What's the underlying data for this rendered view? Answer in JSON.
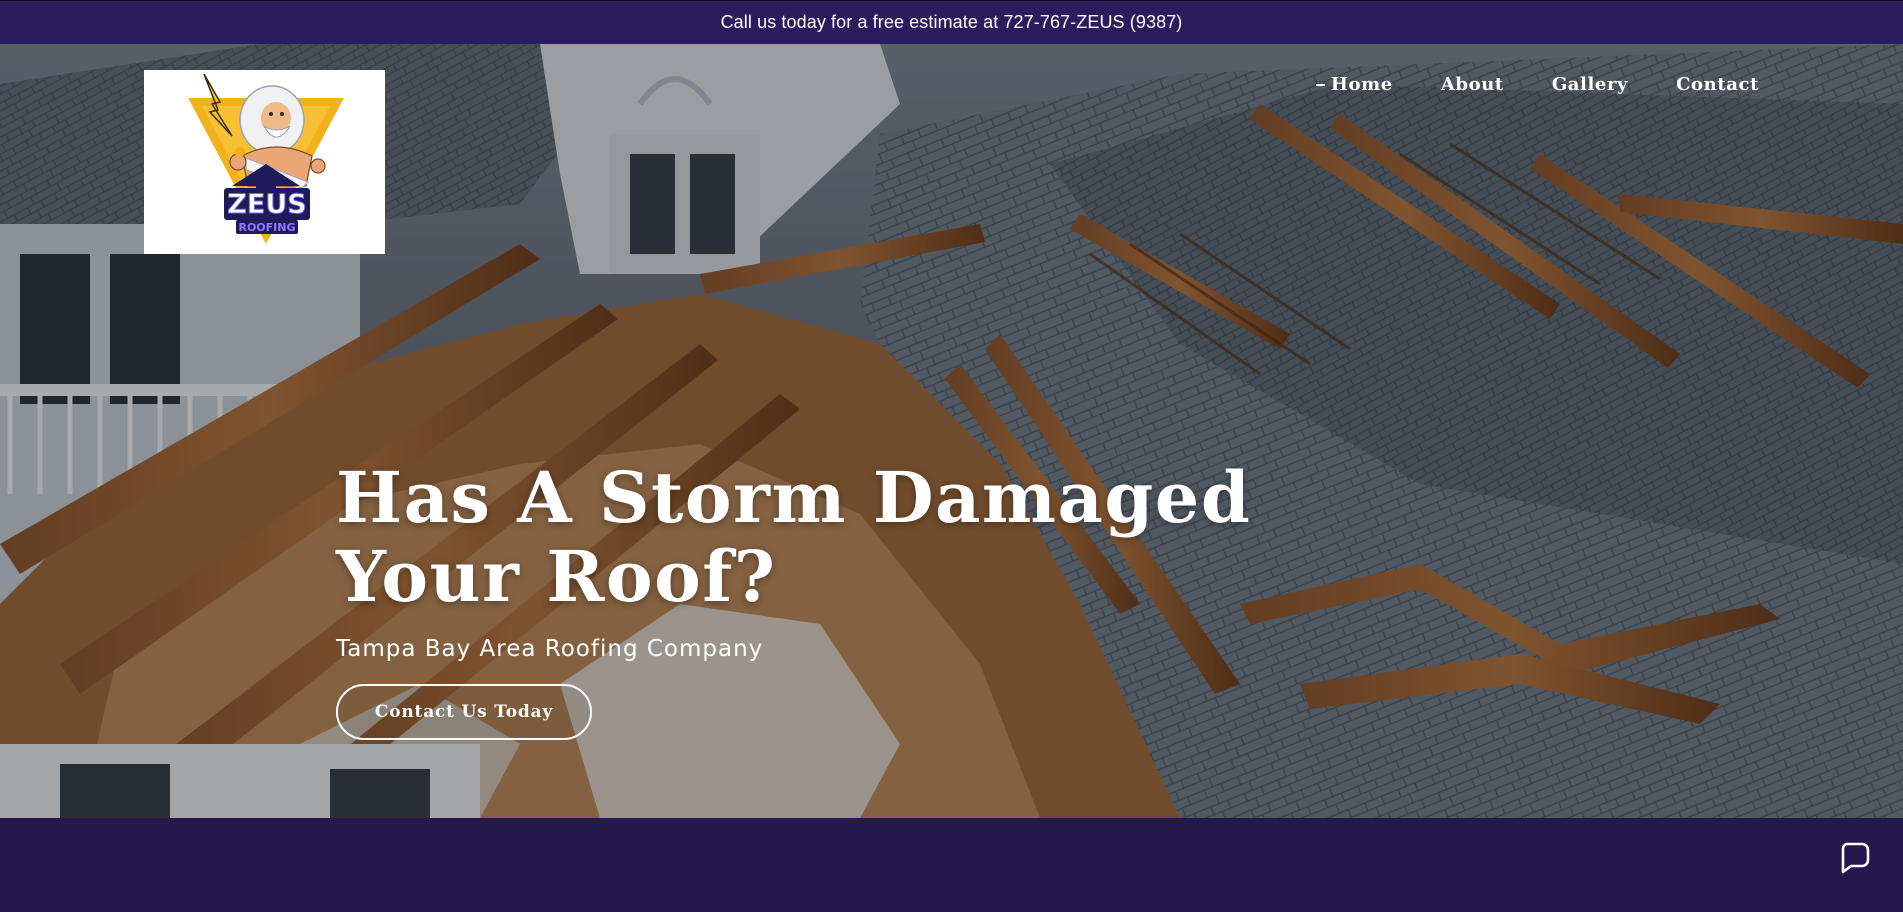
{
  "announcement": {
    "text": "Call us today for a free estimate at 727-767-ZEUS (9387)"
  },
  "logo": {
    "wordmark": "ZEUS",
    "tagline": "ROOFING"
  },
  "nav": {
    "items": [
      {
        "label": "Home",
        "active": true
      },
      {
        "label": "About",
        "active": false
      },
      {
        "label": "Gallery",
        "active": false
      },
      {
        "label": "Contact",
        "active": false
      }
    ]
  },
  "hero": {
    "title": "Has A Storm Damaged Your Roof?",
    "subtitle": "Tampa Bay Area Roofing Company",
    "cta_label": "Contact Us Today"
  },
  "icons": {
    "chat": "chat-bubble-icon",
    "lightning": "lightning-bolt-icon"
  },
  "colors": {
    "brand_purple": "#24184f",
    "banner_purple": "#2a1d5d",
    "logo_gold": "#f2b21b",
    "logo_navy": "#1e1a5b"
  }
}
